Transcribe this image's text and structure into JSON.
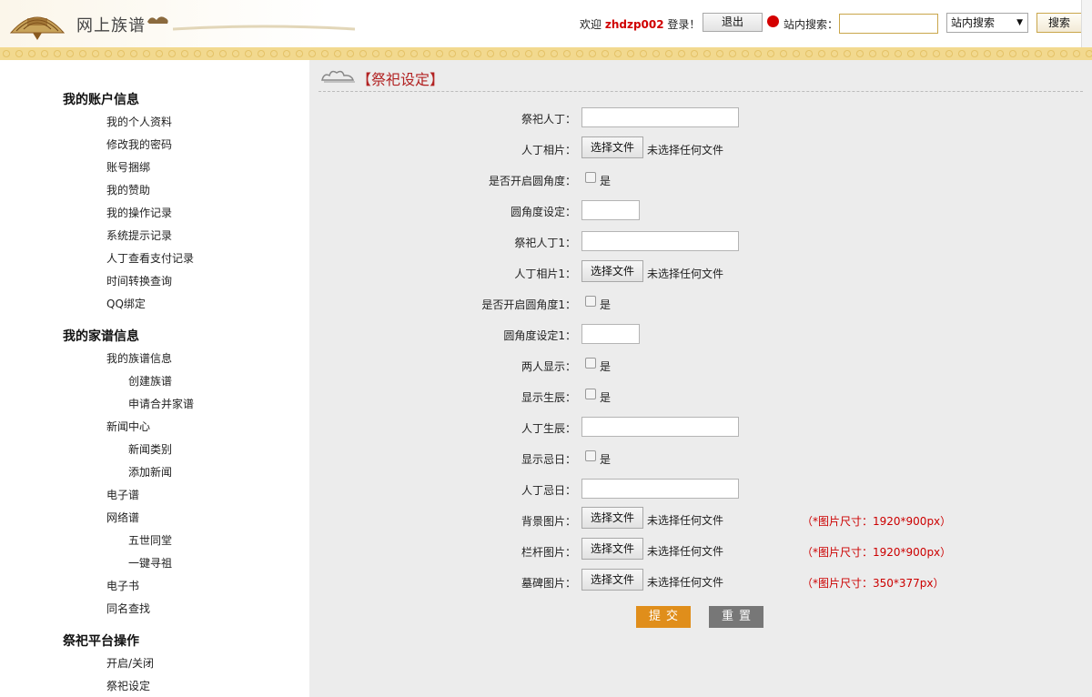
{
  "header": {
    "site_title": "网上族谱",
    "welcome_prefix": "欢迎",
    "username": "zhdzp002",
    "welcome_suffix": "登录！",
    "logout_label": "退出",
    "search_label": "站内搜索：",
    "search_value": "",
    "search_scope": "站内搜索",
    "search_button": "搜索"
  },
  "sidebar": {
    "sections": [
      {
        "title": "我的账户信息",
        "items": [
          "我的个人资料",
          "修改我的密码",
          "账号捆绑",
          "我的赞助",
          "我的操作记录",
          "系统提示记录",
          "人丁查看支付记录",
          "时间转换查询",
          "QQ绑定"
        ]
      },
      {
        "title": "我的家谱信息",
        "items": [
          "我的族谱信息",
          "创建族谱",
          "申请合并家谱",
          "新闻中心",
          "新闻类别",
          "添加新闻",
          "电子谱",
          "网络谱",
          "五世同堂",
          "一键寻祖",
          "电子书",
          "同名查找"
        ]
      },
      {
        "title": "祭祀平台操作",
        "items": [
          "开启/关闭",
          "祭祀设定"
        ]
      }
    ]
  },
  "main": {
    "heading": "【祭祀设定】",
    "no_file": "未选择任何文件",
    "choose_file": "选择文件",
    "yes": "是",
    "fields": {
      "person": "祭祀人丁：",
      "photo": "人丁相片：",
      "rounded": "是否开启圆角度：",
      "radius": "圆角度设定：",
      "person1": "祭祀人丁1：",
      "photo1": "人丁相片1：",
      "rounded1": "是否开启圆角度1：",
      "radius1": "圆角度设定1：",
      "two_show": "两人显示：",
      "show_birth": "显示生辰：",
      "birth": "人丁生辰：",
      "show_death": "显示忌日：",
      "death": "人丁忌日：",
      "bg_image": "背景图片：",
      "rail_image": "栏杆图片：",
      "tomb_image": "墓碑图片："
    },
    "hints": {
      "bg": "（*图片尺寸：1920*900px）",
      "rail": "（*图片尺寸：1920*900px）",
      "tomb": "（*图片尺寸：350*377px）"
    },
    "submit_label": "提交",
    "reset_label": "重置"
  },
  "colors": {
    "accent_red": "#b22222",
    "submit_orange": "#e08e1b",
    "reset_gray": "#777777",
    "band_gold": "#f2d98f"
  }
}
